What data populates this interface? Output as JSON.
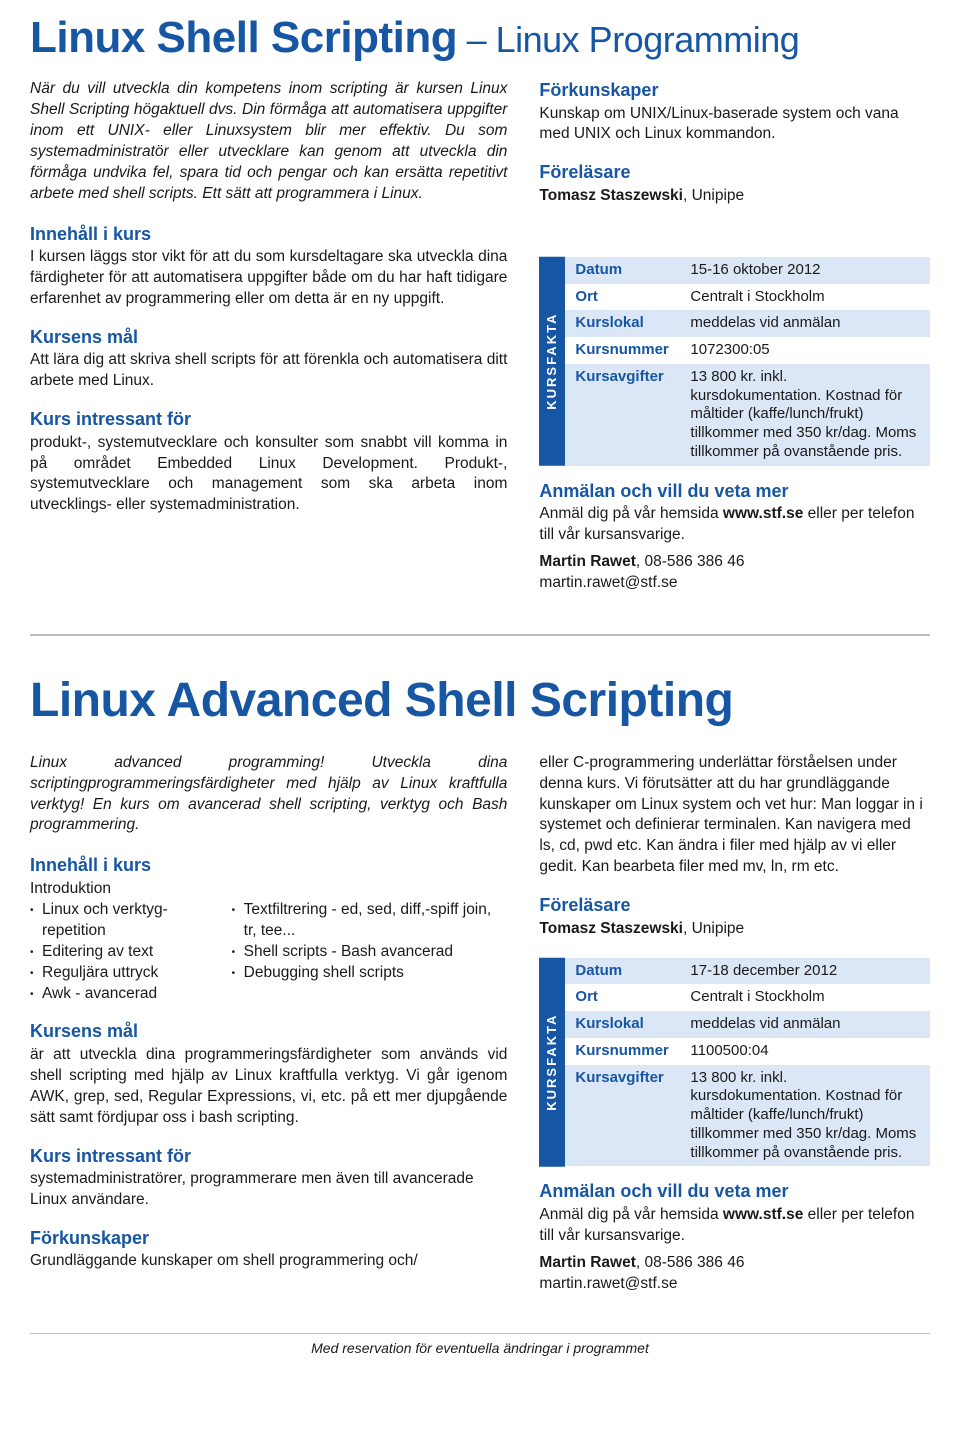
{
  "course1": {
    "title_main": "Linux Shell Scripting",
    "title_sub": " – Linux Programming",
    "intro": "När du vill utveckla din kompetens inom scripting är kursen Linux Shell Scripting högaktuell dvs. Din förmåga att automatisera uppgifter inom ett UNIX- eller Linuxsystem blir mer effektiv. Du som systemadministratör eller utvecklare kan genom att utveckla din förmåga undvika fel, spara tid och pengar och kan ersätta repetitivt arbete med shell scripts. Ett sätt att programmera i Linux.",
    "sections": {
      "innehall_h": "Innehåll i kurs",
      "innehall_body": "I kursen läggs stor vikt för att du som kursdeltagare ska utveckla dina färdigheter för att automatisera uppgifter både om du har haft tidigare erfarenhet av programmering eller om detta är en ny uppgift.",
      "mal_h": "Kursens mål",
      "mal_body": "Att lära dig att skriva shell scripts för att förenkla och automatisera ditt arbete med Linux.",
      "intressant_h": "Kurs intressant för",
      "intressant_body": "produkt-, systemutvecklare och konsulter som snabbt vill komma in på området Embedded Linux Development. Produkt-, systemutvecklare och management som ska arbeta inom utvecklings- eller systemadministration."
    },
    "right": {
      "forkunskaper_h": "Förkunskaper",
      "forkunskaper_body": "Kunskap om UNIX/Linux-baserade system och vana med UNIX och Linux kommandon.",
      "forelasare_h": "Föreläsare",
      "forelasare_name": "Tomasz Staszewski",
      "forelasare_org": ", Unipipe"
    },
    "fakta_label": "KURSFAKTA",
    "fakta": [
      {
        "k": "Datum",
        "v": "15-16 oktober 2012"
      },
      {
        "k": "Ort",
        "v": "Centralt i Stockholm"
      },
      {
        "k": "Kurslokal",
        "v": "meddelas vid anmälan"
      },
      {
        "k": "Kursnummer",
        "v": "1072300:05"
      },
      {
        "k": "Kursavgifter",
        "v": "13 800 kr. inkl. kursdokumentation. Kostnad för måltider (kaffe/lunch/frukt) tillkommer med 350 kr/dag. Moms tillkommer på ovanstående pris."
      }
    ],
    "anmalan": {
      "h": "Anmälan och vill du veta mer",
      "body_pre": "Anmäl dig på vår hemsida ",
      "site": "www.stf.se",
      "body_post": " eller per telefon till vår kursansvarige.",
      "contact_name": "Martin Rawet",
      "contact_phone": ", 08-586 386 46",
      "contact_email": "martin.rawet@stf.se"
    }
  },
  "course2": {
    "title": "Linux Advanced Shell Scripting",
    "intro": "Linux advanced programming! Utveckla dina scriptingprogrammeringsfärdigheter med hjälp av Linux kraftfulla verktyg! En kurs om avancerad shell scripting, verktyg och Bash programmering.",
    "innehall_h": "Innehåll i kurs",
    "innehall_intro": "Introduktion",
    "list_col1": [
      "Linux och verktyg­repetition",
      "Editering av text",
      "Reguljära uttryck",
      "Awk - avancerad"
    ],
    "list_col2": [
      "Textfiltrering - ed, sed, diff,-spiff join, tr, tee...",
      "Shell scripts - Bash avancerad",
      "Debugging shell scripts"
    ],
    "mal_h": "Kursens mål",
    "mal_body": "är att utveckla dina programmeringsfärdigheter som används vid shell scripting med hjälp av Linux kraftfulla verktyg. Vi går igenom AWK, grep, sed, Regular Expressions, vi, etc. på ett mer djupgående sätt samt fördjupar oss i bash scripting.",
    "intressant_h": "Kurs intressant för",
    "intressant_body": "systemadministratörer, programmerare men även till avancerade Linux användare.",
    "forkunskaper_h": "Förkunskaper",
    "forkunskaper_left": "Grundläggande kunskaper om shell programmering och/",
    "forkunskaper_right": "eller C-programmering underlättar förståelsen under denna kurs. Vi förutsätter att du har grundläggande kunskaper om Linux system och vet hur: Man loggar in i systemet och definierar terminalen. Kan navigera med ls, cd, pwd etc. Kan ändra i filer med hjälp av vi eller gedit. Kan bearbeta filer med mv, ln, rm etc.",
    "forelasare_h": "Föreläsare",
    "forelasare_name": "Tomasz Staszewski",
    "forelasare_org": ", Unipipe",
    "fakta_label": "KURSFAKTA",
    "fakta": [
      {
        "k": "Datum",
        "v": "17-18 december 2012"
      },
      {
        "k": "Ort",
        "v": "Centralt i Stockholm"
      },
      {
        "k": "Kurslokal",
        "v": "meddelas vid anmälan"
      },
      {
        "k": "Kursnummer",
        "v": "1100500:04"
      },
      {
        "k": "Kursavgifter",
        "v": "13 800 kr. inkl. kursdokumentation. Kostnad för måltider (kaffe/lunch/frukt) tillkommer med 350 kr/dag. Moms tillkommer på ovanstående pris."
      }
    ],
    "anmalan": {
      "h": "Anmälan och vill du veta mer",
      "body_pre": "Anmäl dig på vår hemsida ",
      "site": "www.stf.se",
      "body_post": " eller per telefon till vår kursansvarige.",
      "contact_name": "Martin Rawet",
      "contact_phone": ", 08-586 386 46",
      "contact_email": "martin.rawet@stf.se"
    }
  },
  "footer": "Med reservation för eventuella ändringar i programmet"
}
